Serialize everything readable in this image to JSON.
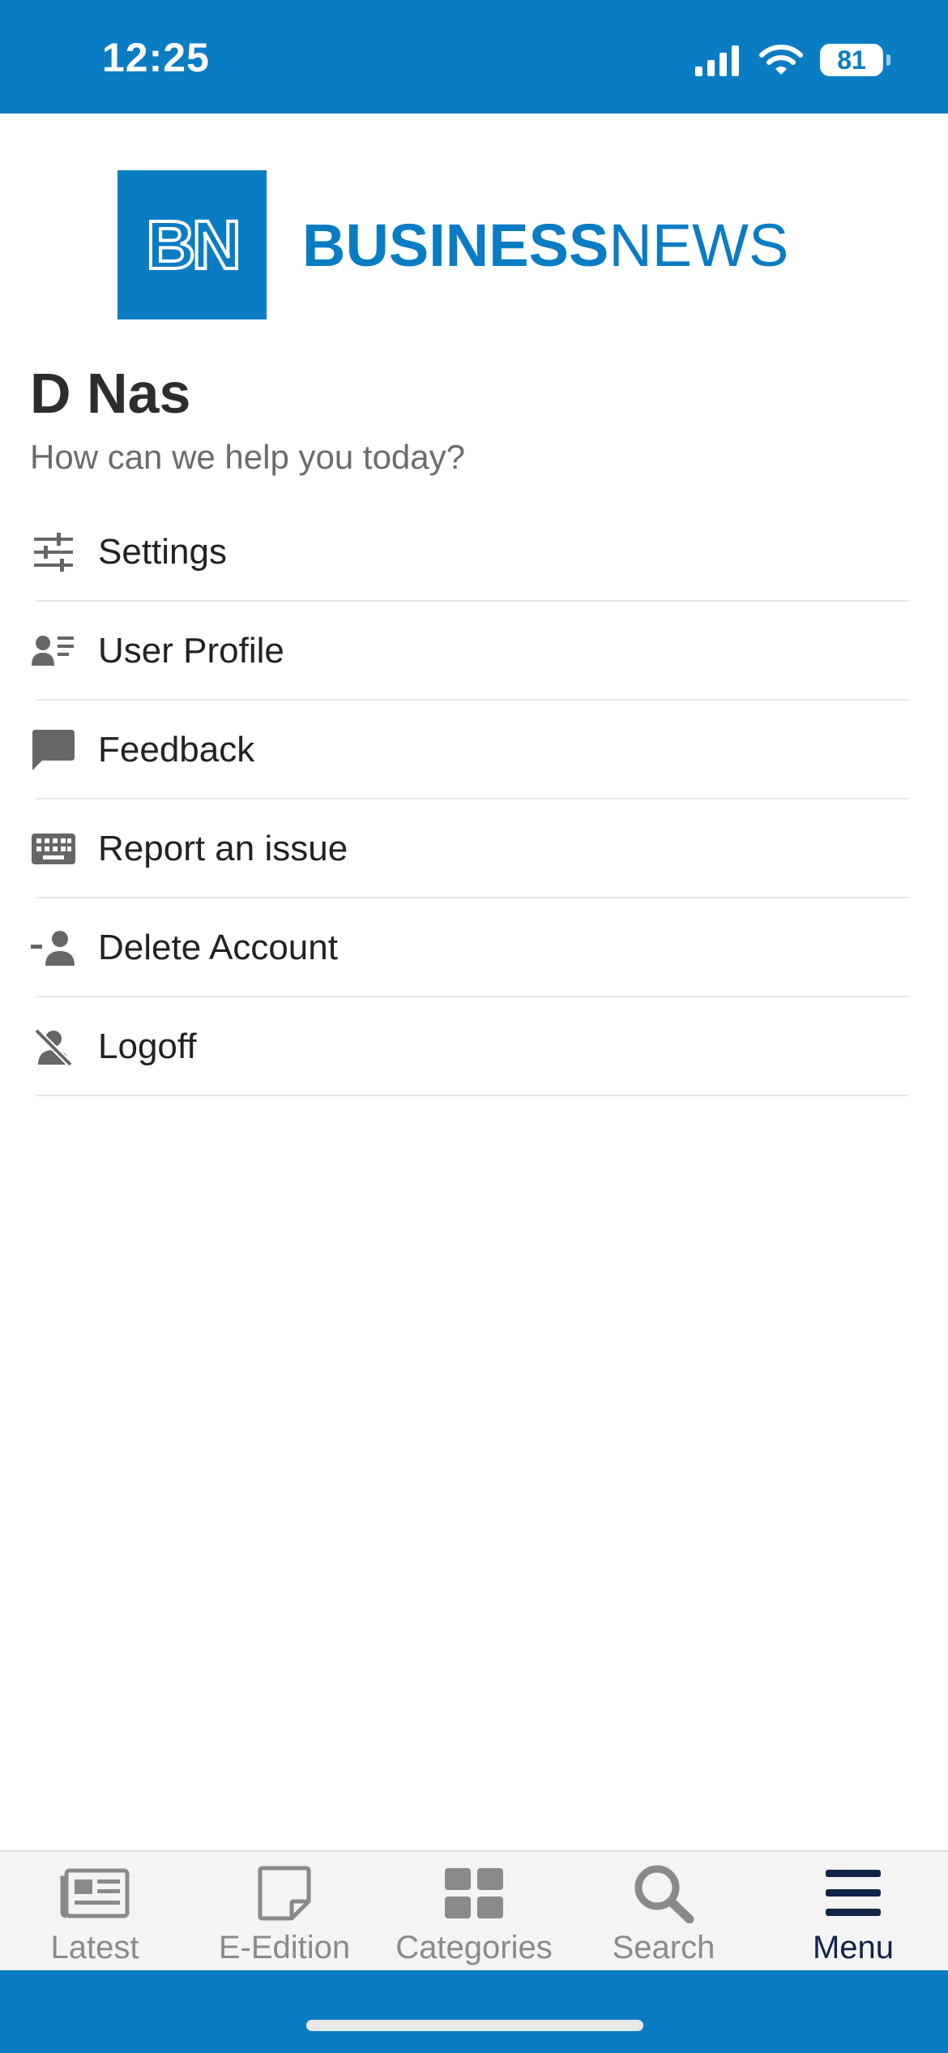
{
  "status_bar": {
    "time": "12:25",
    "battery": "81"
  },
  "logo": {
    "letters": "BN",
    "word_bold": "BUSINESS",
    "word_light": "NEWS"
  },
  "user": {
    "name": "D Nas",
    "subtitle": "How can we help you today?"
  },
  "menu": {
    "items": [
      {
        "label": "Settings",
        "icon": "sliders-icon"
      },
      {
        "label": "User Profile",
        "icon": "user-list-icon"
      },
      {
        "label": "Feedback",
        "icon": "chat-bubble-icon"
      },
      {
        "label": "Report an issue",
        "icon": "keyboard-icon"
      },
      {
        "label": "Delete Account",
        "icon": "person-remove-icon"
      },
      {
        "label": "Logoff",
        "icon": "person-off-icon"
      }
    ]
  },
  "tabs": [
    {
      "label": "Latest",
      "icon": "newspaper-icon"
    },
    {
      "label": "E-Edition",
      "icon": "page-icon"
    },
    {
      "label": "Categories",
      "icon": "grid-icon"
    },
    {
      "label": "Search",
      "icon": "search-icon"
    },
    {
      "label": "Menu",
      "icon": "hamburger-icon",
      "active": true
    }
  ],
  "colors": {
    "brand": "#0a7cc4",
    "active_tab": "#0f2447",
    "icon_gray": "#666666"
  }
}
